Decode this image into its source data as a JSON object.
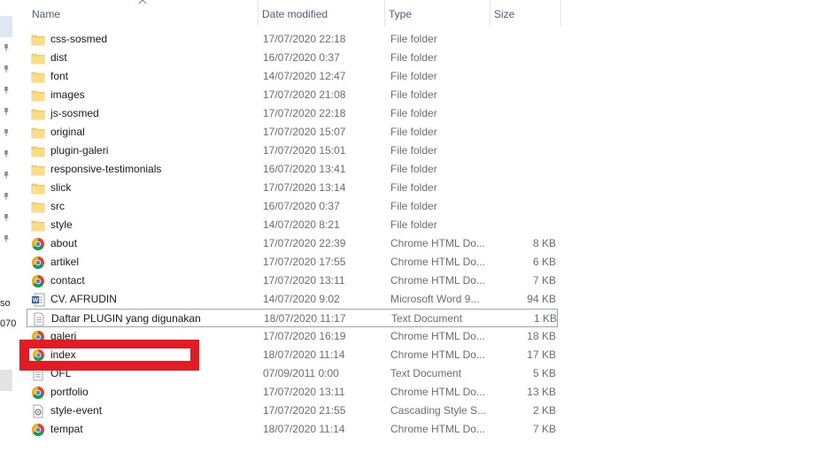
{
  "columns": {
    "name": "Name",
    "date": "Date modified",
    "type": "Type",
    "size": "Size"
  },
  "left_pane": {
    "text1": "so",
    "text2": "070"
  },
  "files": [
    {
      "name": "css-sosmed",
      "date": "17/07/2020 22:18",
      "type": "File folder",
      "size": "",
      "icon": "folder-icon"
    },
    {
      "name": "dist",
      "date": "16/07/2020 0:37",
      "type": "File folder",
      "size": "",
      "icon": "folder-icon"
    },
    {
      "name": "font",
      "date": "14/07/2020 12:47",
      "type": "File folder",
      "size": "",
      "icon": "folder-icon"
    },
    {
      "name": "images",
      "date": "17/07/2020 21:08",
      "type": "File folder",
      "size": "",
      "icon": "folder-icon"
    },
    {
      "name": "js-sosmed",
      "date": "17/07/2020 22:18",
      "type": "File folder",
      "size": "",
      "icon": "folder-icon"
    },
    {
      "name": "original",
      "date": "17/07/2020 15:07",
      "type": "File folder",
      "size": "",
      "icon": "folder-icon"
    },
    {
      "name": "plugin-galeri",
      "date": "17/07/2020 15:01",
      "type": "File folder",
      "size": "",
      "icon": "folder-icon"
    },
    {
      "name": "responsive-testimonials",
      "date": "16/07/2020 13:41",
      "type": "File folder",
      "size": "",
      "icon": "folder-icon"
    },
    {
      "name": "slick",
      "date": "17/07/2020 13:14",
      "type": "File folder",
      "size": "",
      "icon": "folder-icon"
    },
    {
      "name": "src",
      "date": "16/07/2020 0:37",
      "type": "File folder",
      "size": "",
      "icon": "folder-icon"
    },
    {
      "name": "style",
      "date": "14/07/2020 8:21",
      "type": "File folder",
      "size": "",
      "icon": "folder-icon"
    },
    {
      "name": "about",
      "date": "17/07/2020 22:39",
      "type": "Chrome HTML Do...",
      "size": "8 KB",
      "icon": "chrome-icon"
    },
    {
      "name": "artikel",
      "date": "17/07/2020 17:55",
      "type": "Chrome HTML Do...",
      "size": "6 KB",
      "icon": "chrome-icon"
    },
    {
      "name": "contact",
      "date": "17/07/2020 13:11",
      "type": "Chrome HTML Do...",
      "size": "7 KB",
      "icon": "chrome-icon"
    },
    {
      "name": "CV. AFRUDIN",
      "date": "14/07/2020 9:02",
      "type": "Microsoft Word 9...",
      "size": "94 KB",
      "icon": "word-doc-icon"
    },
    {
      "name": "Daftar PLUGIN yang digunakan",
      "date": "18/07/2020 11:17",
      "type": "Text Document",
      "size": "1 KB",
      "icon": "text-doc-icon"
    },
    {
      "name": "galeri",
      "date": "17/07/2020 16:19",
      "type": "Chrome HTML Do...",
      "size": "18 KB",
      "icon": "chrome-icon"
    },
    {
      "name": "index",
      "date": "18/07/2020 11:14",
      "type": "Chrome HTML Do...",
      "size": "17 KB",
      "icon": "chrome-icon"
    },
    {
      "name": "OFL",
      "date": "07/09/2011 0:00",
      "type": "Text Document",
      "size": "5 KB",
      "icon": "text-doc-icon"
    },
    {
      "name": "portfolio",
      "date": "17/07/2020 13:11",
      "type": "Chrome HTML Do...",
      "size": "13 KB",
      "icon": "chrome-icon"
    },
    {
      "name": "style-event",
      "date": "17/07/2020 21:55",
      "type": "Cascading Style S...",
      "size": "2 KB",
      "icon": "css-doc-icon"
    },
    {
      "name": "tempat",
      "date": "18/07/2020 11:14",
      "type": "Chrome HTML Do...",
      "size": "7 KB",
      "icon": "chrome-icon"
    }
  ],
  "selected_name": "Daftar PLUGIN yang digunakan",
  "highlight": {
    "label": "index",
    "color": "#e31b23"
  },
  "colors": {
    "folder": "#f8d775",
    "header_text": "#4c607a",
    "selection_border": "#99a6b8"
  }
}
